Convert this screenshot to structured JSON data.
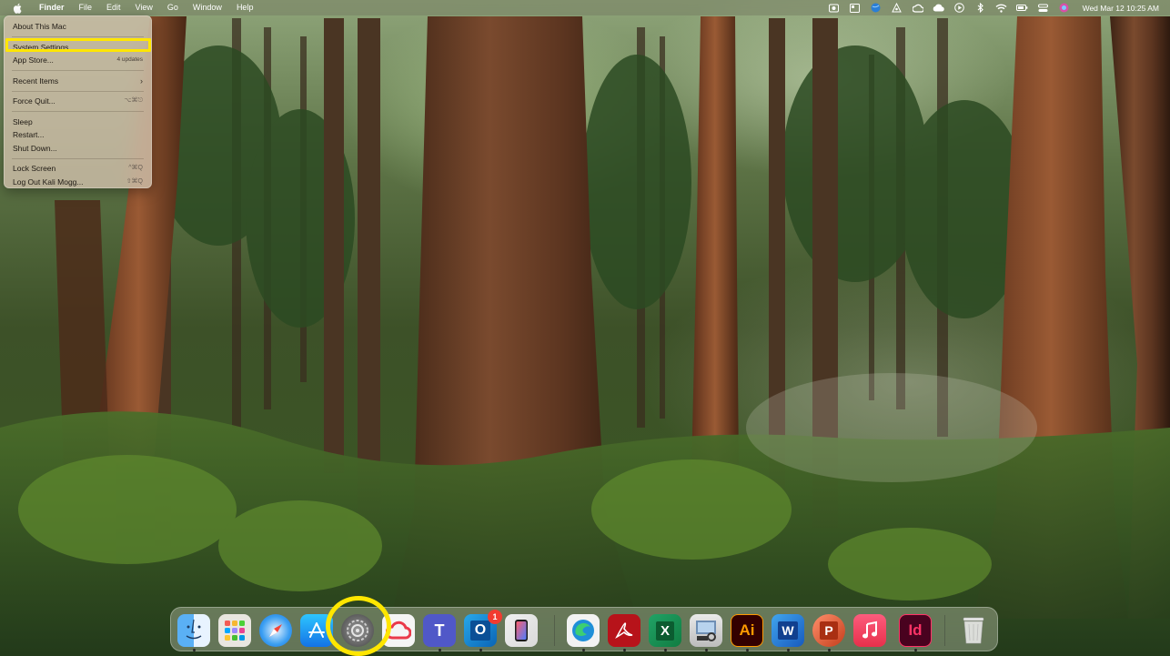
{
  "menubar": {
    "apple_icon": "apple-logo",
    "items": [
      {
        "label": "Finder",
        "bold": true
      },
      {
        "label": "File"
      },
      {
        "label": "Edit"
      },
      {
        "label": "View"
      },
      {
        "label": "Go"
      },
      {
        "label": "Window"
      },
      {
        "label": "Help"
      }
    ],
    "status_icons": [
      "screen-record-icon",
      "app-window-icon",
      "globe-icon",
      "vpn-icon",
      "creative-cloud-icon",
      "cloud-icon",
      "play-icon",
      "bluetooth-icon",
      "wifi-icon",
      "battery-icon",
      "control-center-icon",
      "siri-icon"
    ],
    "clock": "Wed Mar 12  10:25 AM"
  },
  "apple_menu": {
    "about": "About This Mac",
    "system_settings": "System Settings...",
    "app_store": "App Store...",
    "app_store_badge": "4 updates",
    "recent_items": "Recent Items",
    "recent_items_arrow": "›",
    "force_quit": "Force Quit...",
    "force_quit_shortcut": "⌥⌘⎋",
    "sleep": "Sleep",
    "restart": "Restart...",
    "shut_down": "Shut Down...",
    "lock_screen": "Lock Screen",
    "lock_screen_shortcut": "^⌘Q",
    "log_out": "Log Out Kali Mogg...",
    "log_out_shortcut": "⇧⌘Q"
  },
  "dock": {
    "outlook_badge": "1",
    "illustrator_label": "Ai",
    "indesign_label": "Id",
    "word_label": "W",
    "powerpoint_label": "P",
    "excel_label": "X",
    "outlook_label": "O"
  },
  "colors": {
    "highlight": "#ffe600",
    "menubar": "#78806a"
  }
}
